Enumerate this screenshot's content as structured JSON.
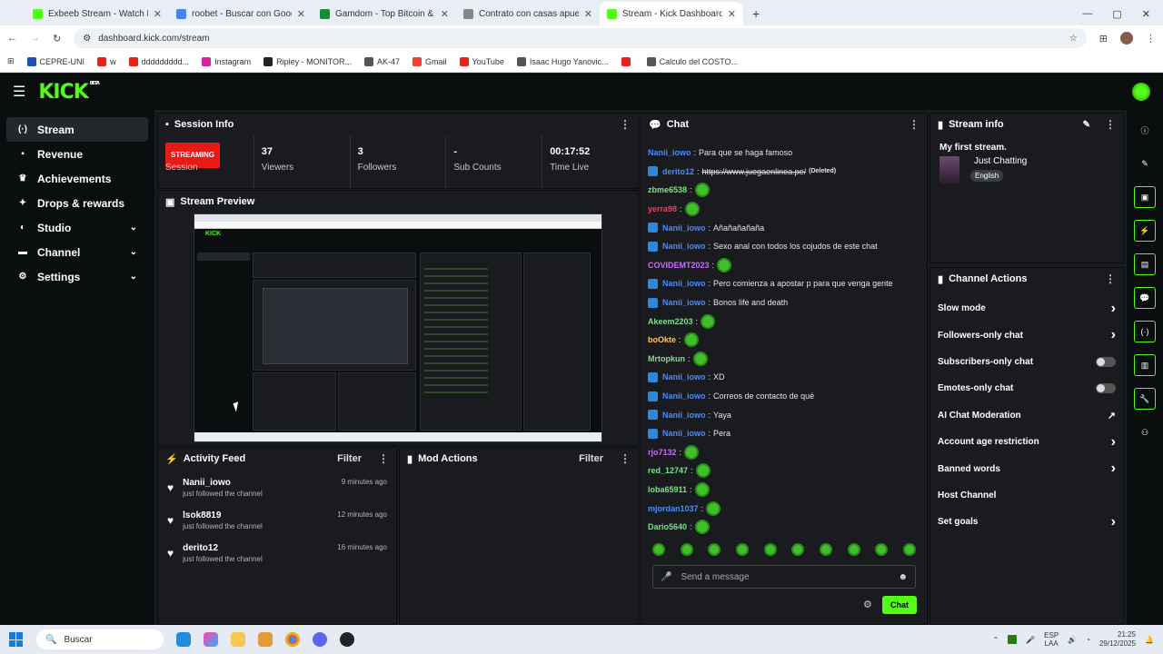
{
  "browser": {
    "tabs": [
      {
        "title": "Exbeeb Stream - Watch Live o",
        "color": "#53fc18",
        "active": false
      },
      {
        "title": "roobet - Buscar con Google",
        "color": "#4285f4",
        "active": false
      },
      {
        "title": "Gamdom - Top Bitcoin & Crypt",
        "color": "#1a8a3a",
        "active": false
      },
      {
        "title": "Contrato con casas apuestas",
        "color": "#888888",
        "active": false
      },
      {
        "title": "Stream - Kick Dashboard",
        "color": "#53fc18",
        "active": true
      }
    ],
    "new_tab": "+",
    "url": "dashboard.kick.com/stream",
    "bookmarks": [
      {
        "label": "CEPRE-UNI",
        "color": "#1e4fb8"
      },
      {
        "label": "w",
        "color": "#e62117"
      },
      {
        "label": "ddddddddd...",
        "color": "#e62117"
      },
      {
        "label": "Instagram",
        "color": "#d6249f"
      },
      {
        "label": "Ripley - MONITOR...",
        "color": "#222222"
      },
      {
        "label": "AK-47",
        "color": "#555555"
      },
      {
        "label": "Gmail",
        "color": "#ea4335"
      },
      {
        "label": "YouTube",
        "color": "#e62117"
      },
      {
        "label": "Isaac Hugo Yanovic...",
        "color": "#555555"
      },
      {
        "label": "",
        "color": "#e62117"
      },
      {
        "label": "Calculo del COSTO...",
        "color": "#555555"
      }
    ]
  },
  "app": {
    "logo": "KICK",
    "beta": "BETA"
  },
  "sidebar": {
    "items": [
      {
        "label": "Stream",
        "icon": "(·)",
        "chevron": false,
        "active": true
      },
      {
        "label": "Revenue",
        "icon": "▪",
        "chevron": false,
        "active": false
      },
      {
        "label": "Achievements",
        "icon": "♛",
        "chevron": false,
        "active": false
      },
      {
        "label": "Drops & rewards",
        "icon": "✦",
        "chevron": false,
        "active": false
      },
      {
        "label": "Studio",
        "icon": "◐",
        "chevron": true,
        "active": false
      },
      {
        "label": "Channel",
        "icon": "▬",
        "chevron": true,
        "active": false
      },
      {
        "label": "Settings",
        "icon": "⚙",
        "chevron": true,
        "active": false
      }
    ]
  },
  "session": {
    "title": "Session Info",
    "status_badge": "STREAMING",
    "session_label": "Session",
    "stats": [
      {
        "value": "37",
        "label": "Viewers"
      },
      {
        "value": "3",
        "label": "Followers"
      },
      {
        "value": "-",
        "label": "Sub Counts"
      },
      {
        "value": "00:17:52",
        "label": "Time Live"
      }
    ]
  },
  "preview": {
    "title": "Stream Preview"
  },
  "activity": {
    "title": "Activity Feed",
    "filter": "Filter",
    "items": [
      {
        "name": "Nanii_iowo",
        "text": "just followed the channel",
        "time": "9 minutes ago"
      },
      {
        "name": "lsok8819",
        "text": "just followed the channel",
        "time": "12 minutes ago"
      },
      {
        "name": "derito12",
        "text": "just followed the channel",
        "time": "16 minutes ago"
      }
    ]
  },
  "mod_actions": {
    "title": "Mod Actions",
    "filter": "Filter"
  },
  "chat": {
    "title": "Chat",
    "messages": [
      {
        "user": "Nanii_iowo",
        "color": "#4a8cff",
        "mod": false,
        "text": "Para que se haga famoso",
        "emote": false
      },
      {
        "user": "derito12",
        "color": "#4a8cff",
        "mod": true,
        "text": "https://www.juegaenlinea.pe/",
        "deleted": "(Deleted)",
        "emote": false
      },
      {
        "user": "zbme6538",
        "color": "#7ee08a",
        "mod": false,
        "text": "",
        "emote": true
      },
      {
        "user": "yerra98",
        "color": "#e64562",
        "mod": false,
        "text": "",
        "emote": true
      },
      {
        "user": "Nanii_iowo",
        "color": "#4a8cff",
        "mod": true,
        "text": "Añañañañaña",
        "emote": false
      },
      {
        "user": "Nanii_iowo",
        "color": "#4a8cff",
        "mod": true,
        "text": "Sexo anal con todos los cojudos de este chat",
        "emote": false
      },
      {
        "user": "COVIDEMT2023",
        "color": "#c86cff",
        "mod": false,
        "text": "",
        "emote": true
      },
      {
        "user": "Nanii_iowo",
        "color": "#4a8cff",
        "mod": true,
        "text": "Pero comienza a apostar p para que venga gente",
        "emote": false
      },
      {
        "user": "Nanii_iowo",
        "color": "#4a8cff",
        "mod": true,
        "text": "Bonos life and death",
        "emote": false
      },
      {
        "user": "Akeem2203",
        "color": "#7ee08a",
        "mod": false,
        "text": "",
        "emote": true
      },
      {
        "user": "boOkte",
        "color": "#ffc46b",
        "mod": false,
        "text": "",
        "emote": true
      },
      {
        "user": "Mrtopkun",
        "color": "#7ee08a",
        "mod": false,
        "text": "",
        "emote": true
      },
      {
        "user": "Nanii_iowo",
        "color": "#4a8cff",
        "mod": true,
        "text": "XD",
        "emote": false
      },
      {
        "user": "Nanii_iowo",
        "color": "#4a8cff",
        "mod": true,
        "text": "Correos de contacto de qué",
        "emote": false
      },
      {
        "user": "Nanii_iowo",
        "color": "#4a8cff",
        "mod": true,
        "text": "Yaya",
        "emote": false
      },
      {
        "user": "Nanii_iowo",
        "color": "#4a8cff",
        "mod": true,
        "text": "Pera",
        "emote": false
      },
      {
        "user": "rjo7132",
        "color": "#c86cff",
        "mod": false,
        "text": "",
        "emote": true
      },
      {
        "user": "red_12747",
        "color": "#7ee08a",
        "mod": false,
        "text": "",
        "emote": true
      },
      {
        "user": "loba65911",
        "color": "#7ee08a",
        "mod": false,
        "text": "",
        "emote": true
      },
      {
        "user": "mjordan1037",
        "color": "#4a8cff",
        "mod": false,
        "text": "",
        "emote": true
      },
      {
        "user": "Dario5640",
        "color": "#7ee08a",
        "mod": false,
        "text": "",
        "emote": true
      }
    ],
    "input_placeholder": "Send a message",
    "send_label": "Chat",
    "emote_count": 10
  },
  "stream_info": {
    "title": "Stream info",
    "stream_title": "My first stream.",
    "category": "Just Chatting",
    "language": "English"
  },
  "channel_actions": {
    "title": "Channel Actions",
    "items": [
      {
        "label": "Slow mode",
        "control": "chevron"
      },
      {
        "label": "Followers-only chat",
        "control": "chevron"
      },
      {
        "label": "Subscribers-only chat",
        "control": "toggle"
      },
      {
        "label": "Emotes-only chat",
        "control": "toggle"
      },
      {
        "label": "AI Chat Moderation",
        "control": "external"
      },
      {
        "label": "Account age restriction",
        "control": "chevron"
      },
      {
        "label": "Banned words",
        "control": "chevron"
      },
      {
        "label": "Host Channel",
        "control": "none"
      },
      {
        "label": "Set goals",
        "control": "chevron"
      }
    ]
  },
  "taskbar": {
    "search_placeholder": "Buscar",
    "lang_top": "ESP",
    "lang_bottom": "LAA",
    "time": "21:25",
    "date": "29/12/2025"
  }
}
